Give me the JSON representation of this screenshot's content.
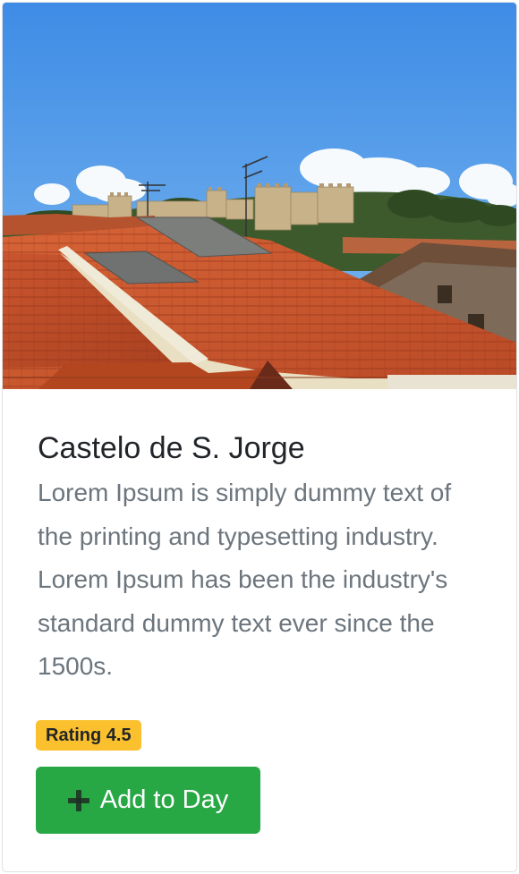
{
  "card": {
    "image_alt": "Rooftops of Lisbon with São Jorge Castle on the hill",
    "title": "Castelo de S. Jorge",
    "description": "Lorem Ipsum is simply dummy text of the printing and typesetting industry. Lorem Ipsum has been the industry's standard dummy text ever since the 1500s.",
    "rating_label": "Rating 4.5",
    "add_button_label": "Add to Day",
    "add_button_icon": "plus-icon"
  },
  "colors": {
    "title": "#212529",
    "description": "#6c757d",
    "rating_badge": "#fbc02d",
    "add_button": "#28a745",
    "card_border": "#dfe1e4"
  }
}
